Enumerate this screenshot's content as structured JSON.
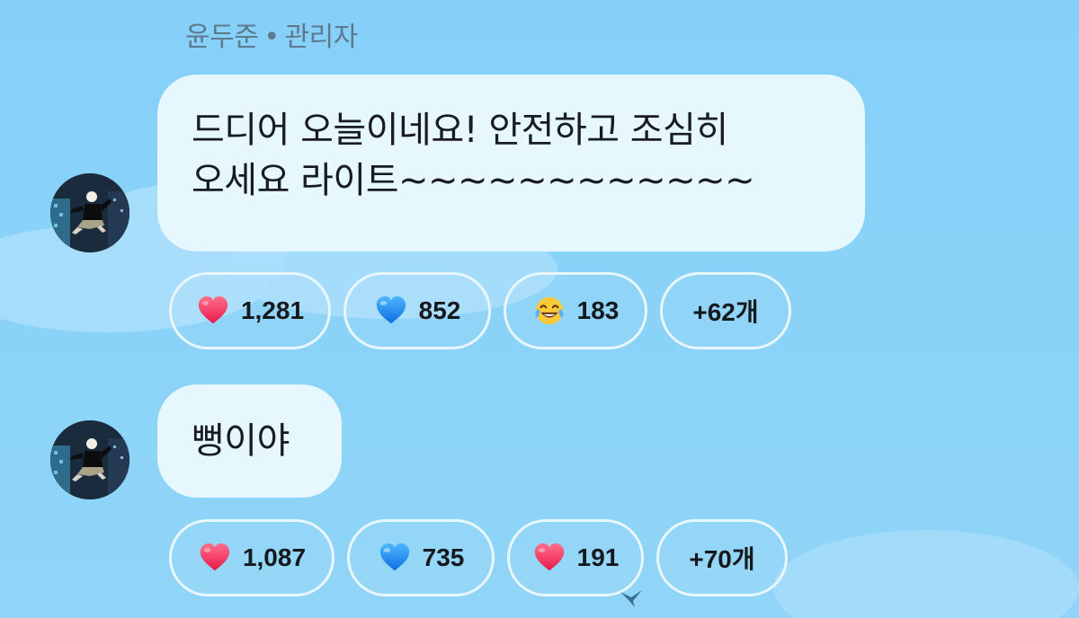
{
  "sender": {
    "name": "윤두준",
    "separator": "•",
    "role": "관리자"
  },
  "messages": [
    {
      "lines": [
        "드디어 오늘이네요! 안전하고 조심히",
        "오세요 라이트~~~~~~~~~~~~"
      ],
      "reactions": [
        {
          "emoji": "red-heart-icon",
          "count": "1,281"
        },
        {
          "emoji": "blue-heart-icon",
          "count": "852"
        },
        {
          "emoji": "tears-of-joy-icon",
          "count": "183"
        },
        {
          "more": "+62개"
        }
      ]
    },
    {
      "lines": [
        "뻥이야"
      ],
      "reactions": [
        {
          "emoji": "red-heart-icon",
          "count": "1,087"
        },
        {
          "emoji": "blue-heart-icon",
          "count": "735"
        },
        {
          "emoji": "red-heart-icon",
          "count": "191"
        },
        {
          "more": "+70개"
        }
      ]
    }
  ],
  "colors": {
    "background": "#86d0f8",
    "bubble": "#e6f7fe",
    "name_text": "#5d7a8c",
    "red_heart": "#f0345c",
    "blue_heart": "#1e8ef0"
  }
}
